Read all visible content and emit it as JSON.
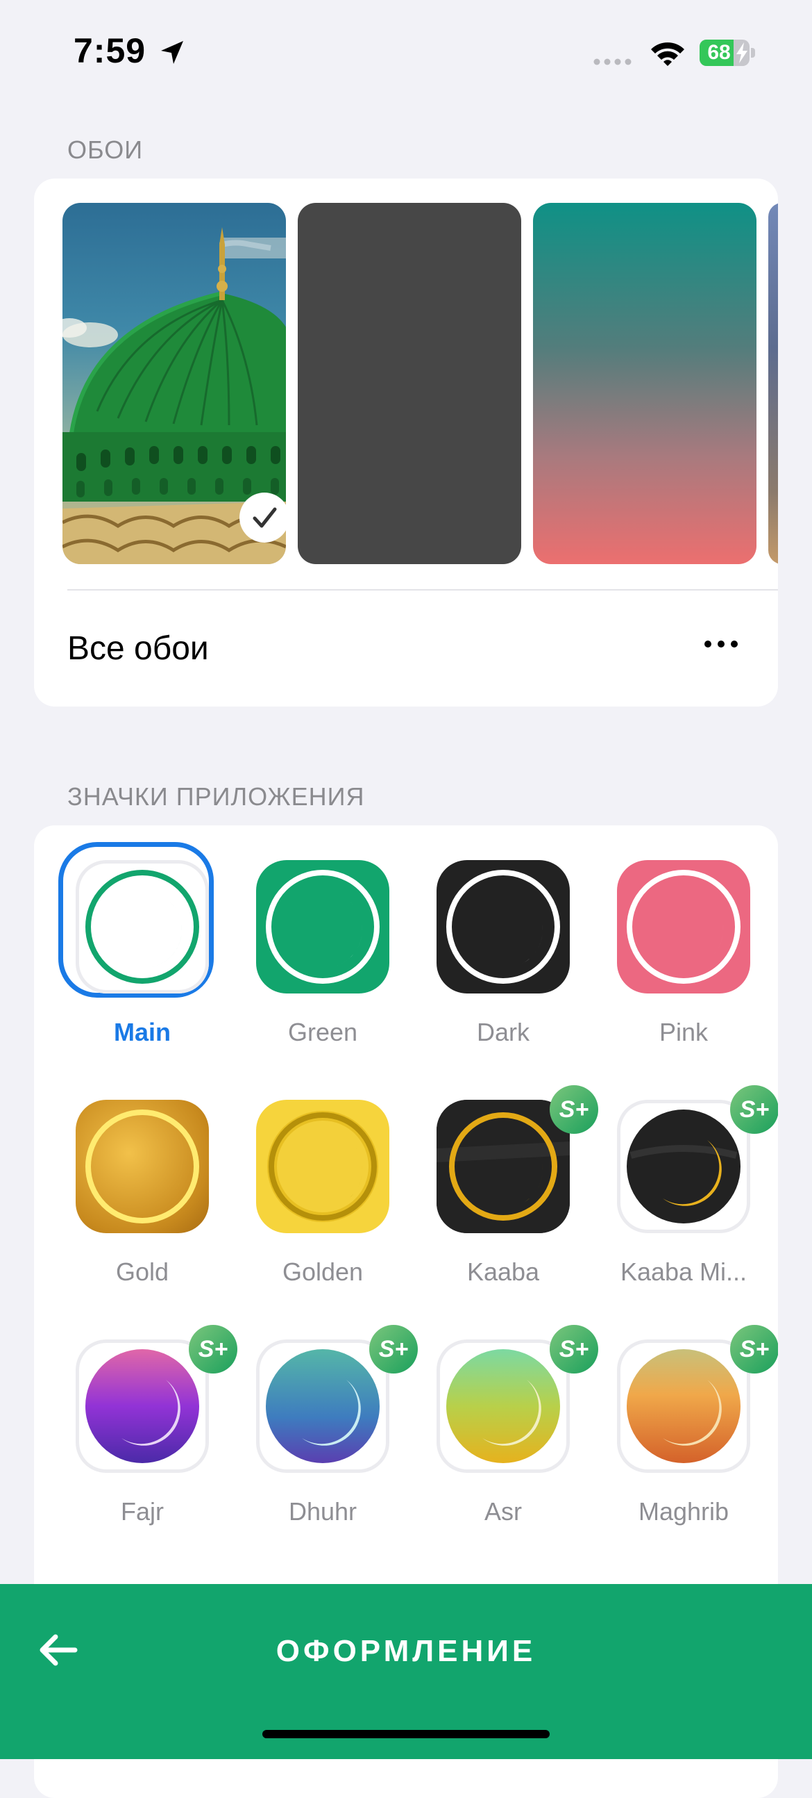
{
  "status_bar": {
    "time": "7:59",
    "battery": "68",
    "battery_level": 0.68
  },
  "wallpapers": {
    "header": "ОБОИ",
    "all_label": "Все обои",
    "selected_index": 0
  },
  "app_icons": {
    "header": "ЗНАЧКИ ПРИЛОЖЕНИЯ",
    "badge": "S+",
    "items": [
      {
        "label": "Main",
        "selected": true
      },
      {
        "label": "Green"
      },
      {
        "label": "Dark"
      },
      {
        "label": "Pink"
      },
      {
        "label": "Gold"
      },
      {
        "label": "Golden"
      },
      {
        "label": "Kaaba",
        "premium": true
      },
      {
        "label": "Kaaba Mi...",
        "premium": true
      },
      {
        "label": "Fajr",
        "premium": true
      },
      {
        "label": "Dhuhr",
        "premium": true
      },
      {
        "label": "Asr",
        "premium": true
      },
      {
        "label": "Maghrib",
        "premium": true
      }
    ]
  },
  "nav": {
    "title": "ОФОРМЛЕНИЕ"
  },
  "colors": {
    "accent": "#12a56d",
    "selection": "#1a7ae6"
  }
}
